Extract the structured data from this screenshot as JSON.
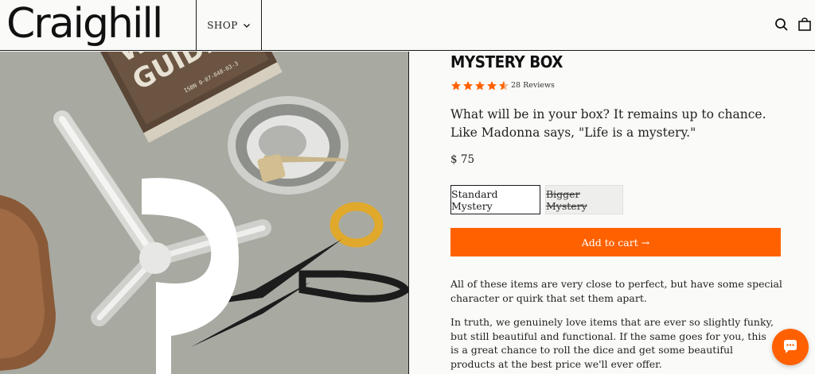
{
  "header": {
    "logo": "Craighill",
    "shop_label": "SHOP"
  },
  "hero": {
    "book_text": [
      "WORLD",
      "GUIDE",
      "WOR",
      "GU"
    ],
    "isbn": "ISBN 0-07-048-03-3"
  },
  "product": {
    "title": "MYSTERY BOX",
    "rating": 4.5,
    "reviews_label": "28 Reviews",
    "description": "What will be in your box? It remains up to chance. Like Madonna says, \"Life is a mystery.\"",
    "price": "$ 75",
    "variants": [
      "Standard Mystery",
      "Bigger Mystery"
    ],
    "selected_variant": "Standard Mystery",
    "add_to_cart": "Add to cart →",
    "body_1": "All of these items are very close to perfect, but have some special character or quirk that set them apart.",
    "body_2": "In truth, we genuinely love items that are ever so slightly funky, but still beautiful and functional. If the same goes for you, this is a great chance to roll the dice and get some beautiful products at the best price we'll ever offer."
  },
  "colors": {
    "accent": "#ff6100",
    "text": "#1a1a1a",
    "background": "#fafaf8"
  },
  "icons": [
    "chevron-down-icon",
    "search-icon",
    "bag-icon",
    "star-icon",
    "chat-icon"
  ]
}
